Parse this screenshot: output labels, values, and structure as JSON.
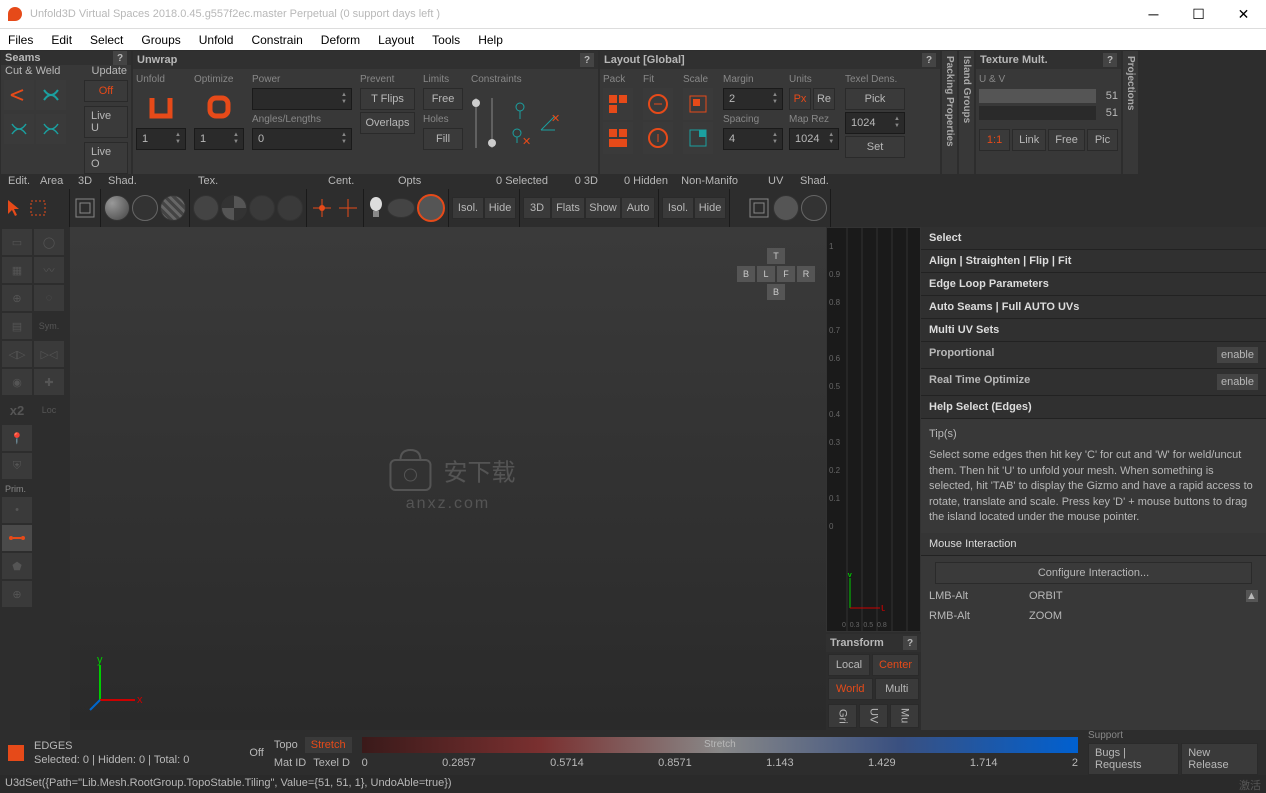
{
  "title": "Unfold3D   Virtual Spaces 2018.0.45.g557f2ec.master Perpetual  (0 support days left )",
  "menu": [
    "Files",
    "Edit",
    "Select",
    "Groups",
    "Unfold",
    "Constrain",
    "Deform",
    "Layout",
    "Tools",
    "Help"
  ],
  "seams": {
    "title": "Seams",
    "cutWeld": "Cut & Weld",
    "update": "Update",
    "off": "Off",
    "liveU": "Live U",
    "liveO": "Live O"
  },
  "unwrap": {
    "title": "Unwrap",
    "unfold": "Unfold",
    "optimize": "Optimize",
    "power": "Power",
    "prevent": "Prevent",
    "limits": "Limits",
    "constraints": "Constraints",
    "anglesLengths": "Angles/Lengths",
    "holes": "Holes",
    "tflips": "T Flips",
    "overlaps": "Overlaps",
    "free": "Free",
    "fill": "Fill",
    "v1": "1",
    "v2": "1",
    "v3": "0"
  },
  "layout": {
    "title": "Layout [Global]",
    "pack": "Pack",
    "fit": "Fit",
    "scale": "Scale",
    "margin": "Margin",
    "units": "Units",
    "texelDens": "Texel Dens.",
    "spacing": "Spacing",
    "mapRez": "Map Rez",
    "marginV": "2",
    "spacingV": "4",
    "px": "Px",
    "re": "Re",
    "pick": "Pick",
    "set": "Set",
    "rez1": "1024",
    "rez2": "1024"
  },
  "vtabs": {
    "packing": "Packing Properties",
    "island": "Island Groups",
    "projections": "Projections"
  },
  "texmult": {
    "title": "Texture Mult.",
    "uv": "U & V",
    "v1": "51",
    "v2": "51",
    "oneone": "1:1",
    "link": "Link",
    "free": "Free",
    "pic": "Pic"
  },
  "tbhdr": {
    "edit": "Edit.",
    "area": "Area",
    "threed": "3D",
    "shad": "Shad.",
    "tex": "Tex.",
    "cent": "Cent.",
    "opts": "Opts",
    "uv": "UV"
  },
  "tbinfo": {
    "selected": "0 Selected",
    "threeD": "0 3D",
    "hidden": "0 Hidden",
    "nonmanifo": "Non-Manifo"
  },
  "tbbtns": {
    "isol": "Isol.",
    "hide": "Hide",
    "threeD": "3D",
    "flats": "Flats",
    "show": "Show",
    "auto": "Auto"
  },
  "left": {
    "sym": "Sym.",
    "loc": "Loc",
    "x2": "x2",
    "prim": "Prim."
  },
  "right": {
    "select": "Select",
    "align": "Align | Straighten | Flip | Fit",
    "edgeloop": "Edge Loop Parameters",
    "autoseams": "Auto Seams | Full AUTO UVs",
    "multiuv": "Multi UV Sets",
    "proportional": "Proportional",
    "realtime": "Real Time Optimize",
    "enable": "enable",
    "helpselect": "Help Select (Edges)",
    "tips": "Tip(s)",
    "tiptext": "Select some edges then hit key 'C' for cut and 'W' for weld/uncut them. Then hit 'U' to unfold your mesh. When something is selected, hit 'TAB' to display the Gizmo and have a rapid access to rotate, translate and scale. Press key 'D' + mouse buttons to drag the island located under the mouse pointer.",
    "mouseint": "Mouse Interaction",
    "configint": "Configure Interaction...",
    "lmbalt": "LMB-Alt",
    "orbit": "ORBIT",
    "rmbalt": "RMB-Alt",
    "zoom": "ZOOM"
  },
  "transform": {
    "title": "Transform",
    "local": "Local",
    "center": "Center",
    "world": "World",
    "multi": "Multi",
    "gri": "Gri",
    "uv": "UV",
    "mu": "Mu"
  },
  "nav": {
    "t": "T",
    "b": "B",
    "l": "L",
    "f": "F",
    "r": "R",
    "b2": "B"
  },
  "watermark": {
    "line1": "安下载",
    "line2": "anxz.com"
  },
  "status": {
    "edges": "EDGES",
    "selinfo": "Selected: 0 | Hidden: 0 | Total: 0",
    "off": "Off",
    "topo": "Topo",
    "stretch": "Stretch",
    "matid": "Mat ID",
    "texeld": "Texel D",
    "gradlabel": "Stretch",
    "ticks": [
      "0",
      "0.2857",
      "0.5714",
      "0.8571",
      "1.143",
      "1.429",
      "1.714",
      "2"
    ],
    "support": "Support",
    "bugs": "Bugs | Requests",
    "newrel": "New Release"
  },
  "cmd": "U3dSet({Path=\"Lib.Mesh.RootGroup.TopoStable.Tiling\", Value={51, 51, 1}, UndoAble=true})",
  "activate": "激活"
}
